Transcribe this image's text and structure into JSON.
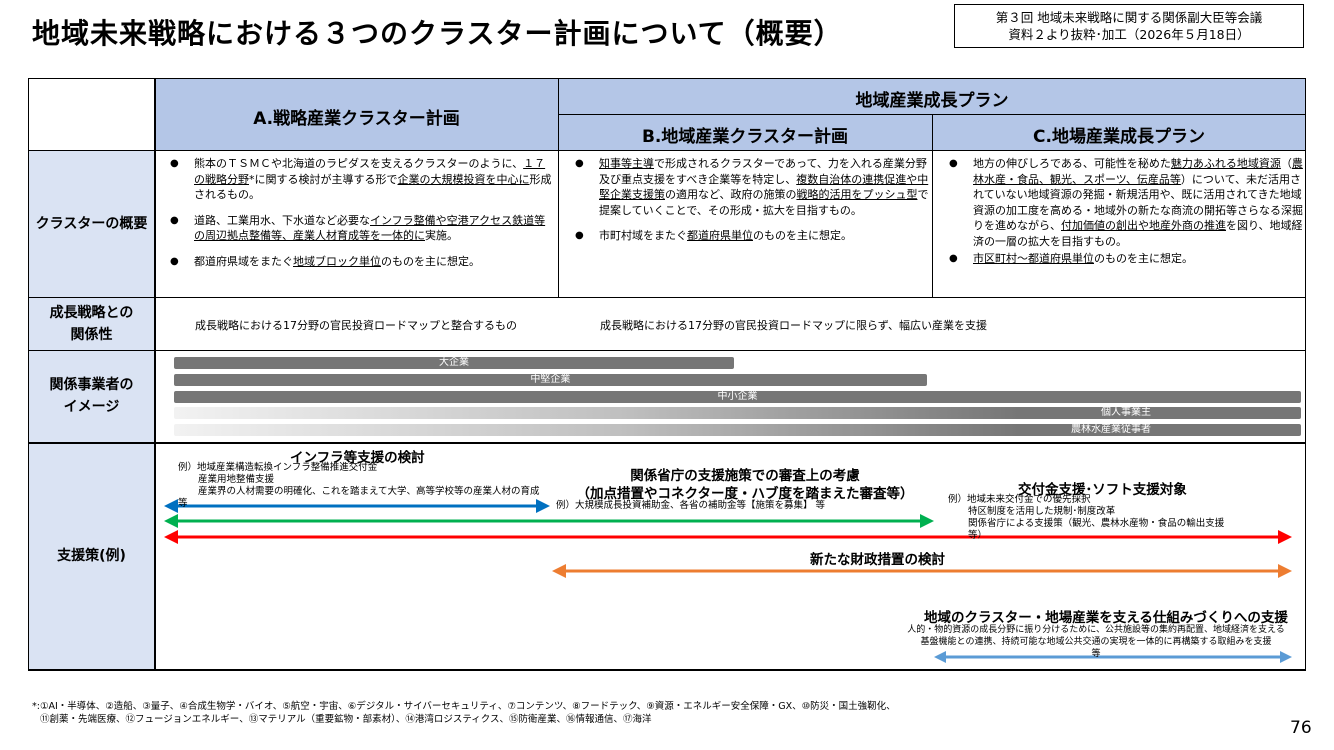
{
  "title": "地域未来戦略における３つのクラスター計画について（概要）",
  "source": {
    "line1": "第３回 地域未来戦略に関する関係副大臣等会議",
    "line2": "資料２より抜粋･加工（2026年５月18日）"
  },
  "header": {
    "col_a": "A.戦略産業クラスター計画",
    "group_bc": "地域産業成長プラン",
    "col_b": "B.地域産業クラスター計画",
    "col_c": "C.地場産業成長プラン"
  },
  "rows": {
    "overview": "クラスターの概要",
    "relation_line1": "成長戦略との",
    "relation_line2": "関係性",
    "business_line1": "関係事業者の",
    "business_line2": "イメージ",
    "support": "支援策(例)"
  },
  "overview": {
    "a": [
      [
        "熊本のＴＳＭＣや北海道のラピダスを支えるクラスターのように、",
        "１７の戦略分野",
        "*に関する検討が主導する形で",
        "企業の大規模投資を中心に",
        "形成されるもの。"
      ],
      [
        "道路、工業用水、下水道など必要な",
        "インフラ整備や空港アクセス鉄道等の周辺拠点整備等、産業人材育成等を一体的に",
        "実施。"
      ],
      [
        "都道府県域をまたぐ",
        "地域ブロック単位",
        "のものを主に想定。"
      ]
    ],
    "b": [
      [
        "知事等主導",
        "で形成されるクラスターであって、力を入れる産業分野及び重点支援をすべき企業等を特定し、",
        "複数自治体の連携促進や中堅企業支援策",
        "の適用など、政府の施策の",
        "戦略的活用をプッシュ型",
        "で提案していくことで、その形成・拡大を目指すもの。"
      ],
      [
        "市町村域をまたぐ",
        "都道府県単位",
        "のものを主に想定。"
      ]
    ],
    "c": [
      [
        "地方の伸びしろである、可能性を秘めた",
        "魅力あふれる地域資源",
        "（",
        "農林水産・食品、観光、スポーツ、伝産品等",
        "）について、未だ活用されていない地域資源の発掘・新規活用や、既に活用されてきた地域資源の加工度を高める・地域外の新たな商流の開拓等さらなる深掘りを進めながら、",
        "付加価値の創出や地産外商の推進",
        "を図り、地域経済の一層の拡大を目指すもの。"
      ],
      [
        "市区町村～都道府県単位",
        "のものを主に想定。"
      ]
    ]
  },
  "relation": {
    "a": "成長戦略における17分野の官民投資ロードマップと整合するもの",
    "bc": "成長戦略における17分野の官民投資ロードマップに限らず、幅広い産業を支援"
  },
  "business": [
    {
      "label": "大企業",
      "start": 0.0,
      "end": 0.497
    },
    {
      "label": "中堅企業",
      "start": 0.0,
      "end": 0.668
    },
    {
      "label": "中小企業",
      "start": 0.0,
      "end": 1.0
    },
    {
      "label": "個人事業主",
      "start": 0.0,
      "end": 1.0
    },
    {
      "label": "農林水産業従事者",
      "start": 0.0,
      "end": 1.0
    }
  ],
  "support": {
    "infra_title": "インフラ等支援の検討",
    "infra_ex": [
      "例）地域産業構造転換インフラ整備推進交付金",
      "産業用地整備支援",
      "産業界の人材需要の明確化、これを踏まえて大学、高等学校等の産業人材の育成",
      "等"
    ],
    "review_title_1": "関係省庁の支援施策での審査上の考慮",
    "review_title_2": "（加点措置やコネクター度・ハブ度を踏まえた審査等）",
    "review_ex": "例）大規模成長投資補助金、各省の補助金等【施策を募集】 等",
    "grant_title": "交付金支援･ソフト支援対象",
    "grant_ex": [
      "例）地域未来交付金での優先採択",
      "特区制度を活用した規制･制度改革",
      "関係省庁による支援策（観光、農林水産物・食品の輸出支援",
      "等）"
    ],
    "fiscal_title": "新たな財政措置の検討",
    "mech_title": "地域のクラスター・地場産業を支える仕組みづくりへの支援",
    "mech_ex": [
      "人的・物的資源の成長分野に振り分けるために、公共施設等の集約再配置、地域経済を支える",
      "基盤機能との連携、持続可能な地域公共交通の実現を一体的に再構築する取組みを支援",
      "等"
    ]
  },
  "colors": {
    "header": "#b4c6e7",
    "side": "#dae3f3",
    "arrow_blue": "#0070c0",
    "arrow_green": "#00b050",
    "arrow_red": "#ff0000",
    "arrow_orange": "#ed7d31",
    "arrow_lightblue": "#5b9bd5",
    "bar_gray": "#767676"
  },
  "footnote": {
    "line1": "*:①AI・半導体、②造船、③量子、④合成生物学・バイオ、⑤航空・宇宙、⑥デジタル・サイバーセキュリティ、⑦コンテンツ、⑧フードテック、⑨資源・エネルギー安全保障・GX、⑩防災・国土強靭化、",
    "line2": "⑪創薬・先端医療、⑫フュージョンエネルギー、⑬マテリアル（重要鉱物・部素材）、⑭港湾ロジスティクス、⑮防衛産業、⑯情報通信、⑰海洋"
  },
  "page": "76"
}
